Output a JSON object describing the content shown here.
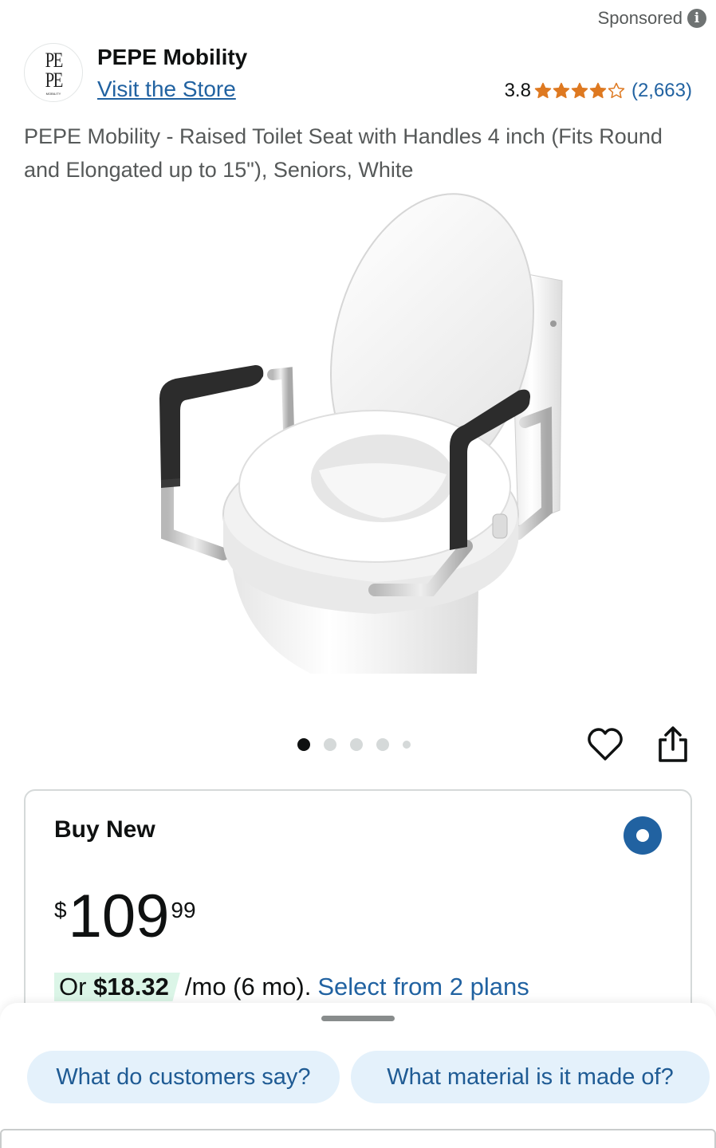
{
  "sponsored": {
    "label": "Sponsored",
    "icon": "info-icon"
  },
  "brand": {
    "logo_lines": [
      "PE",
      "PE"
    ],
    "logo_subtext": "MOBILITY",
    "name": "PEPE Mobility",
    "store_link": "Visit the Store"
  },
  "rating": {
    "score": "3.8",
    "stars": 3.8,
    "count": "(2,663)",
    "star_color": "#de7921"
  },
  "product": {
    "title": "PEPE Mobility - Raised Toilet Seat with Handles 4 inch (Fits Round and Elongated up to 15\"), Seniors, White",
    "image": "raised-toilet-seat-with-handles",
    "carousel": {
      "count": 5,
      "active_index": 0
    },
    "actions": [
      "heart-icon",
      "share-icon"
    ]
  },
  "buy_box": {
    "heading": "Buy New",
    "selected": true,
    "price": {
      "symbol": "$",
      "whole": "109",
      "fraction": "99"
    },
    "monthly": {
      "prefix": "Or ",
      "amount": "$18.32",
      "term": "/mo (6 mo).",
      "link": "Select from 2 plans"
    }
  },
  "suggestions": {
    "chips": [
      "What do customers say?",
      "What material is it made of?"
    ]
  },
  "colors": {
    "link": "#2162a1",
    "radio": "#2162a1",
    "chip_bg": "#e4f1fb",
    "badge_bg": "#dbf5e7"
  }
}
